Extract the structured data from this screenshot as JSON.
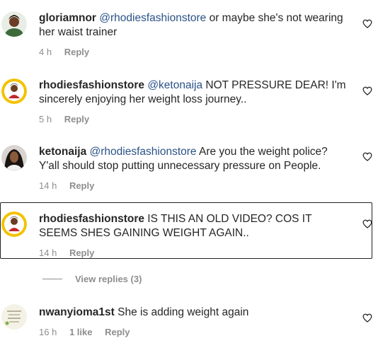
{
  "comments": [
    {
      "username": "gloriamnor",
      "mention": "@rhodiesfashionstore",
      "text": " or maybe she's not wearing her waist trainer",
      "time": "4 h",
      "likes": "",
      "reply": "Reply"
    },
    {
      "username": "rhodiesfashionstore",
      "mention": "@ketonaija",
      "text": " NOT PRESSURE DEAR! I'm sincerely enjoying her weight loss journey..",
      "time": "5 h",
      "likes": "",
      "reply": "Reply"
    },
    {
      "username": "ketonaija",
      "mention": "@rhodiesfashionstore",
      "text": " Are you the weight police? Y'all should stop putting unnecessary pressure on People.",
      "time": "14 h",
      "likes": "",
      "reply": "Reply"
    },
    {
      "username": "rhodiesfashionstore",
      "mention": "",
      "text": " IS THIS AN OLD VIDEO? COS IT SEEMS SHES GAINING WEIGHT AGAIN..",
      "time": "14 h",
      "likes": "",
      "reply": "Reply"
    },
    {
      "username": "nwanyioma1st",
      "mention": "",
      "text": " She is adding weight again",
      "time": "16 h",
      "likes": "1 like",
      "reply": "Reply"
    }
  ],
  "view_replies": "View replies (3)",
  "icons": {
    "like": "heart-outline-icon"
  },
  "colors": {
    "mention": "#2a5288",
    "meta": "#8e8e8e",
    "text": "#262626"
  }
}
